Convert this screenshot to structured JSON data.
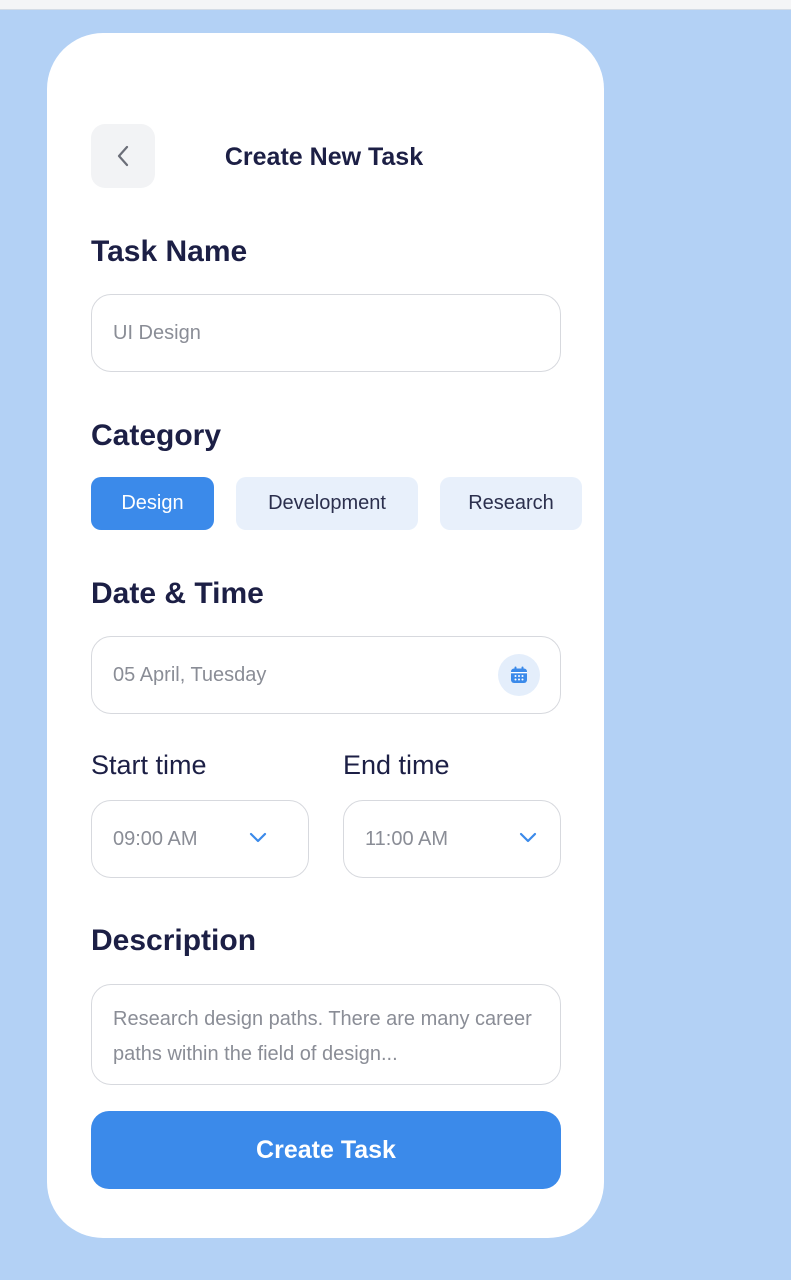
{
  "header": {
    "title": "Create New Task",
    "back_icon": "chevron-left-icon"
  },
  "task_name": {
    "label": "Task Name",
    "placeholder": "UI Design"
  },
  "category": {
    "label": "Category",
    "options": [
      {
        "label": "Design",
        "selected": true
      },
      {
        "label": "Development",
        "selected": false
      },
      {
        "label": "Research",
        "selected": false
      }
    ]
  },
  "date_time": {
    "label": "Date & Time",
    "date_value": "05 April, Tuesday",
    "date_icon": "calendar-icon",
    "start": {
      "label": "Start time",
      "value": "09:00 AM",
      "icon": "chevron-down-icon"
    },
    "end": {
      "label": "End time",
      "value": "11:00 AM",
      "icon": "chevron-down-icon"
    }
  },
  "description": {
    "label": "Description",
    "placeholder": "Research design paths. There are many career paths within the field of design..."
  },
  "submit": {
    "label": "Create Task"
  },
  "colors": {
    "background": "#b3d1f5",
    "accent": "#3b8aea",
    "chip_idle": "#e8f0fb",
    "heading": "#1c1f45",
    "placeholder": "#8a8d96"
  }
}
